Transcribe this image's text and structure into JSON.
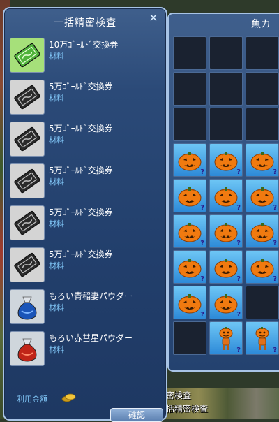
{
  "panel": {
    "title": "一括精密検査",
    "close_symbol": "✕",
    "fee_label": "利用金額",
    "confirm_label": "確認",
    "items": [
      {
        "name": "10万ｺﾞｰﾙﾄﾞ交換券",
        "category": "材料",
        "icon": "green-ticket-icon"
      },
      {
        "name": "5万ｺﾞｰﾙﾄﾞ交換券",
        "category": "材料",
        "icon": "dark-ticket-icon"
      },
      {
        "name": "5万ｺﾞｰﾙﾄﾞ交換券",
        "category": "材料",
        "icon": "dark-ticket-icon"
      },
      {
        "name": "5万ｺﾞｰﾙﾄﾞ交換券",
        "category": "材料",
        "icon": "dark-ticket-icon"
      },
      {
        "name": "5万ｺﾞｰﾙﾄﾞ交換券",
        "category": "材料",
        "icon": "dark-ticket-icon"
      },
      {
        "name": "5万ｺﾞｰﾙﾄﾞ交換券",
        "category": "材料",
        "icon": "dark-ticket-icon"
      },
      {
        "name": "もろい青稲妻パウダー",
        "category": "材料",
        "icon": "blue-powder-bag-icon"
      },
      {
        "name": "もろい赤彗星パウダー",
        "category": "材料",
        "icon": "red-powder-bag-icon"
      }
    ]
  },
  "inventory": {
    "title": "魚カ",
    "slots": [
      "empty",
      "empty",
      "empty",
      "empty",
      "empty",
      "empty",
      "empty",
      "empty",
      "empty",
      "pumpkin",
      "pumpkin",
      "pumpkin",
      "pumpkin",
      "pumpkin",
      "pumpkin",
      "pumpkin",
      "pumpkin",
      "pumpkin",
      "pumpkin",
      "pumpkin",
      "pumpkin",
      "pumpkin",
      "pumpkin",
      "empty",
      "empty",
      "pumpkin-figure",
      "pumpkin-figure"
    ],
    "unknown_mark": "?"
  },
  "background": {
    "texts": [
      "密検査",
      "括精密検査"
    ]
  }
}
